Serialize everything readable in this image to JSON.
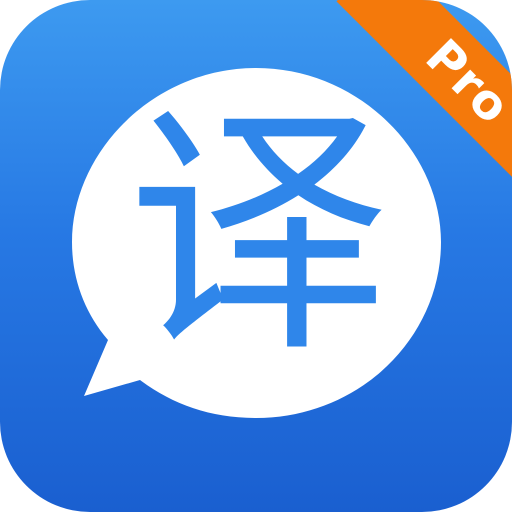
{
  "app_icon": {
    "glyph": "译",
    "badge_label": "Pro",
    "colors": {
      "background_top": "#3d9af0",
      "background_bottom": "#1a5fd0",
      "bubble": "#ffffff",
      "glyph": "#2f86ea",
      "badge": "#f4790b",
      "badge_text": "#ffffff"
    },
    "icons": {
      "bubble": "speech-bubble-icon"
    }
  }
}
